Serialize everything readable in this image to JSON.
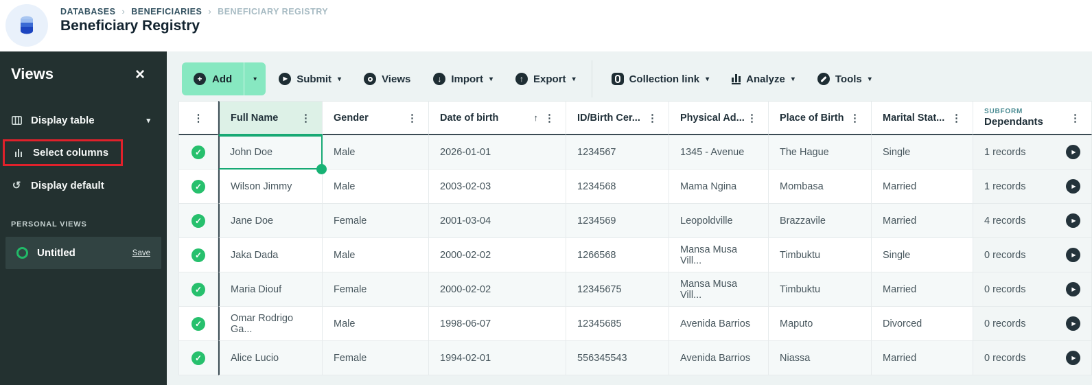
{
  "header": {
    "breadcrumb": [
      {
        "label": "DATABASES"
      },
      {
        "label": "BENEFICIARIES"
      },
      {
        "label": "BENEFICIARY REGISTRY"
      }
    ],
    "title": "Beneficiary Registry",
    "app_icon": "database-icon"
  },
  "sidebar": {
    "title": "Views",
    "close_icon": "close-icon",
    "items": [
      {
        "label": "Display table",
        "icon": "table-icon",
        "has_caret": true
      },
      {
        "label": "Select columns",
        "icon": "columns-icon",
        "highlighted": true
      },
      {
        "label": "Display default",
        "icon": "reset-icon"
      }
    ],
    "section_label": "PERSONAL VIEWS",
    "personal_view": {
      "label": "Untitled",
      "action": "Save"
    }
  },
  "toolbar": {
    "items": [
      {
        "label": "Add",
        "icon": "plus-circle-icon",
        "has_caret": true,
        "style": "primary"
      },
      {
        "label": "Submit",
        "icon": "play-circle-icon",
        "has_caret": true
      },
      {
        "label": "Views",
        "icon": "eye-circle-icon",
        "has_caret": false
      },
      {
        "label": "Import",
        "icon": "import-circle-icon",
        "has_caret": true
      },
      {
        "label": "Export",
        "icon": "export-circle-icon",
        "has_caret": true
      },
      {
        "label": "Collection link",
        "icon": "link-icon",
        "has_caret": true
      },
      {
        "label": "Analyze",
        "icon": "bar-chart-icon",
        "has_caret": true
      },
      {
        "label": "Tools",
        "icon": "wrench-circle-icon",
        "has_caret": true
      }
    ]
  },
  "colors": {
    "add_button_green": "#87e8c1",
    "check_green": "#27c06d",
    "selection_green": "#17a974",
    "sidebar_bg": "#233130",
    "highlight_red": "#e0212b",
    "subform_teal": "#4a8b92",
    "header_selected_bg": "#ddf1e7"
  },
  "table": {
    "columns": [
      {
        "label": "Full Name",
        "selected": true
      },
      {
        "label": "Gender"
      },
      {
        "label": "Date of birth",
        "sorted": "asc"
      },
      {
        "label": "ID/Birth Cer..."
      },
      {
        "label": "Physical Ad..."
      },
      {
        "label": "Place of Birth"
      },
      {
        "label": "Marital Stat..."
      },
      {
        "label": "Dependants",
        "badge": "SUBFORM"
      }
    ],
    "selected_cell": {
      "row": 0,
      "column": "full_name"
    },
    "rows": [
      {
        "full_name": "John Doe",
        "gender": "Male",
        "dob": "2026-01-01",
        "id_cert": "1234567",
        "address": "1345 - Avenue",
        "place": "The Hague",
        "marital": "Single",
        "dependants": "1 records"
      },
      {
        "full_name": "Wilson Jimmy",
        "gender": "Male",
        "dob": "2003-02-03",
        "id_cert": "1234568",
        "address": "Mama Ngina",
        "place": "Mombasa",
        "marital": "Married",
        "dependants": "1 records"
      },
      {
        "full_name": "Jane Doe",
        "gender": "Female",
        "dob": "2001-03-04",
        "id_cert": "1234569",
        "address": "Leopoldville",
        "place": "Brazzavile",
        "marital": "Married",
        "dependants": "4 records"
      },
      {
        "full_name": "Jaka Dada",
        "gender": "Male",
        "dob": "2000-02-02",
        "id_cert": "1266568",
        "address": "Mansa Musa Vill...",
        "place": "Timbuktu",
        "marital": "Single",
        "dependants": "0 records"
      },
      {
        "full_name": "Maria Diouf",
        "gender": "Female",
        "dob": "2000-02-02",
        "id_cert": "12345675",
        "address": "Mansa Musa Vill...",
        "place": "Timbuktu",
        "marital": "Married",
        "dependants": "0 records"
      },
      {
        "full_name": "Omar Rodrigo Ga...",
        "gender": "Male",
        "dob": "1998-06-07",
        "id_cert": "12345685",
        "address": "Avenida Barrios",
        "place": "Maputo",
        "marital": "Divorced",
        "dependants": "0 records"
      },
      {
        "full_name": "Alice Lucio",
        "gender": "Female",
        "dob": "1994-02-01",
        "id_cert": "556345543",
        "address": "Avenida Barrios",
        "place": "Niassa",
        "marital": "Married",
        "dependants": "0 records"
      }
    ]
  }
}
